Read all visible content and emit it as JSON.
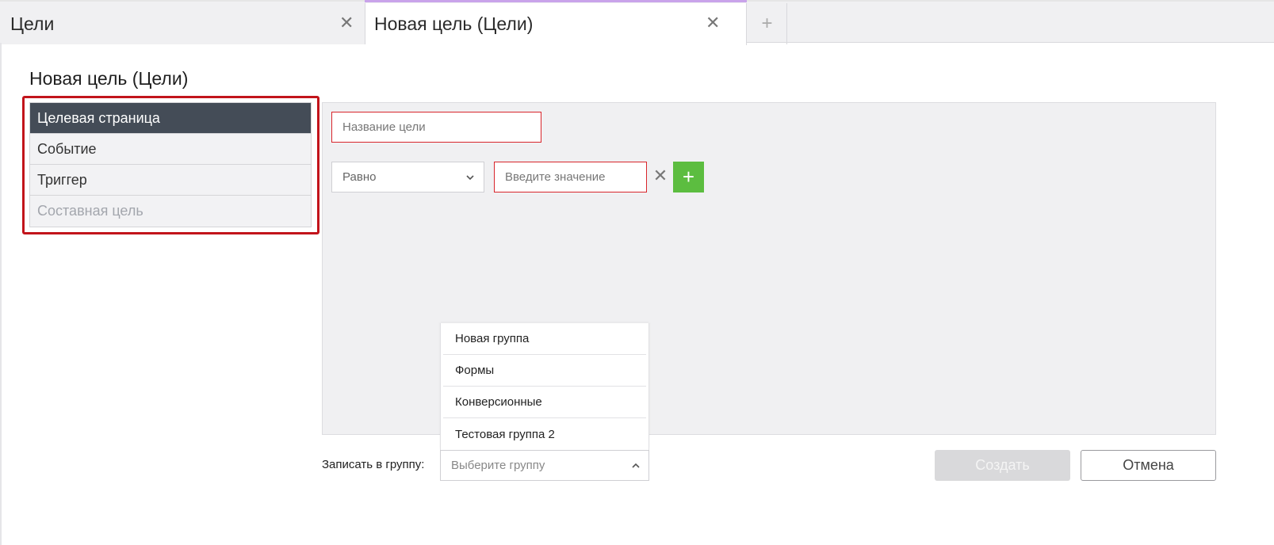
{
  "tabs": [
    {
      "label": "Цели"
    },
    {
      "label": "Новая цель (Цели)"
    }
  ],
  "page": {
    "title": "Новая цель (Цели)"
  },
  "goal_types": [
    {
      "label": "Целевая страница",
      "state": "active"
    },
    {
      "label": "Событие",
      "state": "normal"
    },
    {
      "label": "Триггер",
      "state": "normal"
    },
    {
      "label": "Составная цель",
      "state": "disabled"
    }
  ],
  "form": {
    "name_placeholder": "Название цели",
    "condition_selected": "Равно",
    "value_placeholder": "Введите значение"
  },
  "groups": {
    "options": [
      "Новая группа",
      "Формы",
      "Конверсионные",
      "Тестовая группа 2"
    ],
    "label": "Записать в группу:",
    "placeholder": "Выберите группу"
  },
  "actions": {
    "create": "Создать",
    "cancel": "Отмена"
  },
  "colors": {
    "active_type": "#444c57",
    "error_border": "#d8252b",
    "add_button": "#5cbd40",
    "highlight_box": "#c2141b"
  }
}
